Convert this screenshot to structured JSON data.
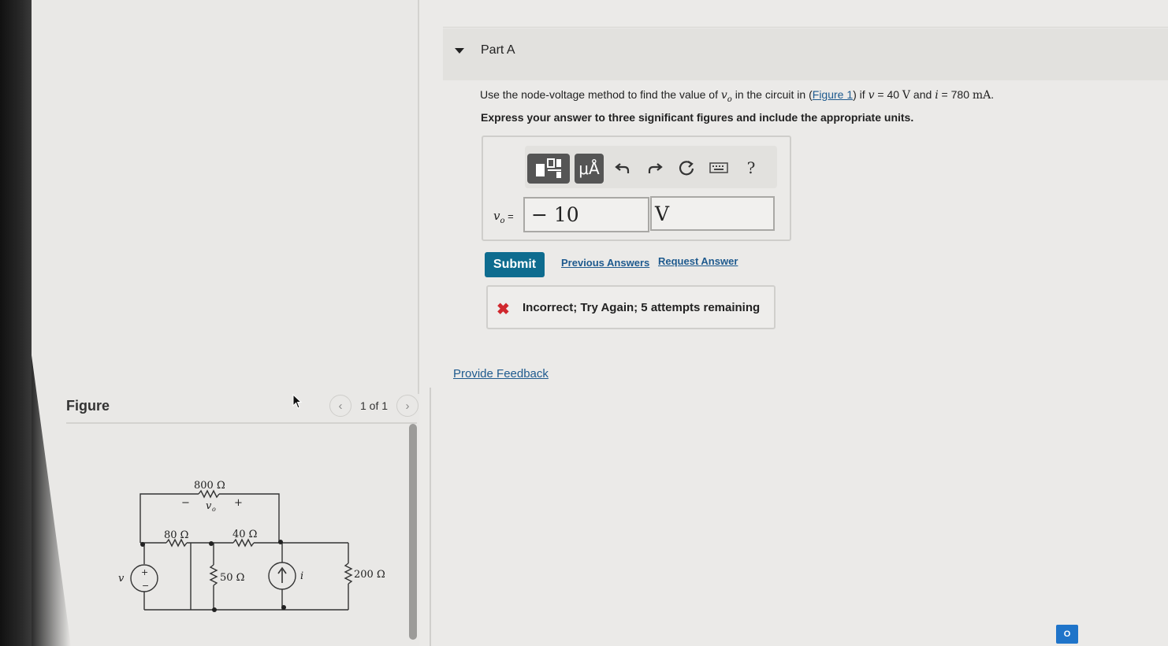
{
  "part": {
    "title": "Part A"
  },
  "question": {
    "prefix": "Use the node-voltage method to find the value of ",
    "var_vo": "v",
    "var_vo_sub": "o",
    "middle": " in the circuit in (",
    "figure_link": "Figure 1",
    "after_link": ") if ",
    "var_v": "v",
    "eq1": " = 40 ",
    "unit_v": "V",
    "and": " and ",
    "var_i": "i",
    "eq2": " = 780 ",
    "unit_ma": "mA",
    "end": "."
  },
  "instruction": "Express your answer to three significant figures and include the appropriate units.",
  "toolbar": {
    "templates_icon": "templates-icon",
    "units_label": "μÅ",
    "undo_icon": "undo-icon",
    "redo_icon": "redo-icon",
    "reset_icon": "reset-icon",
    "keyboard_icon": "keyboard-icon",
    "help_label": "?"
  },
  "answer": {
    "label_var": "v",
    "label_sub": "o",
    "label_eq": " =",
    "value": "− 10",
    "unit": "V"
  },
  "actions": {
    "submit": "Submit",
    "previous_answers": "Previous Answers",
    "request_answer": "Request Answer"
  },
  "feedback": {
    "status": "Incorrect; Try Again; 5 attempts remaining",
    "provide_feedback": "Provide Feedback"
  },
  "figure": {
    "title": "Figure",
    "pager": "1 of 1",
    "prev_glyph": "‹",
    "next_glyph": "›",
    "circuit_labels": {
      "r800": "800 Ω",
      "vo_minus": "−",
      "vo_plus": "+",
      "vo": "v",
      "vo_sub": "o",
      "r80": "80 Ω",
      "r40": "40 Ω",
      "r50": "50 Ω",
      "r200": "200 Ω",
      "source_v": "v",
      "source_i": "i",
      "src_plus": "+",
      "src_minus": "−"
    }
  },
  "colors": {
    "submit_bg": "#0e6c8f",
    "link": "#1e5a8e",
    "error_x": "#d0282e"
  }
}
